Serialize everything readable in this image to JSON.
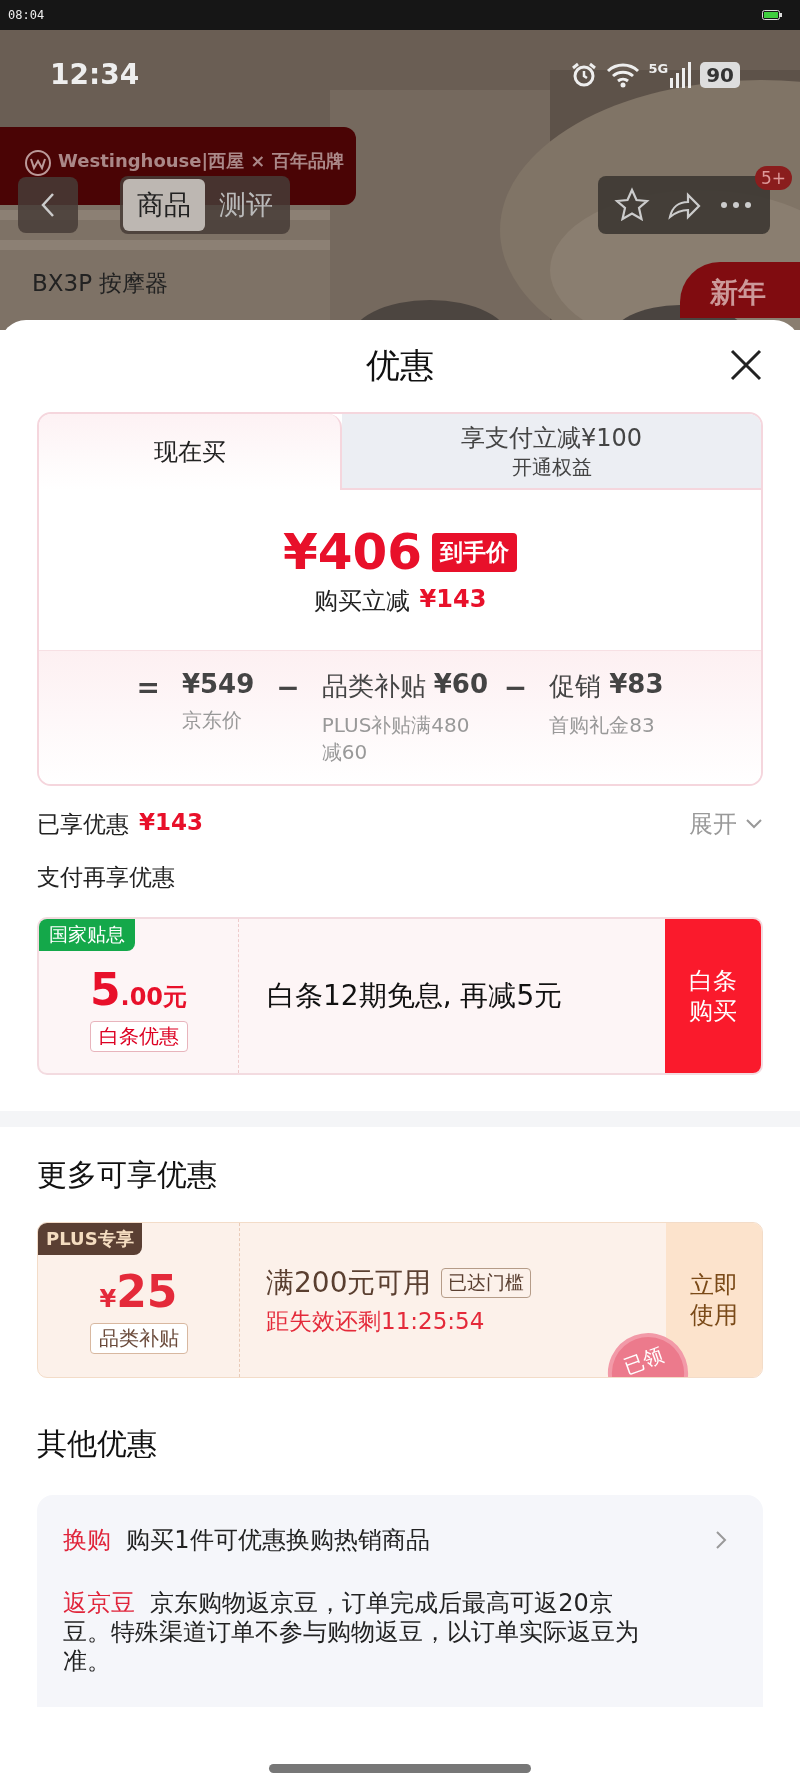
{
  "system_status_bar": {
    "time": "08:04"
  },
  "product_page": {
    "kind": "picture",
    "status_time": "12:34",
    "network": "5G",
    "battery": "90",
    "brand_banner": "Westinghouse|西屋 × 百年品牌",
    "tabs": [
      {
        "label": "商品",
        "selected": true
      },
      {
        "label": "测评",
        "selected": false
      }
    ],
    "message_badge": "5+",
    "subtitle": "BX3P 按摩器",
    "promo_tag": "新年"
  },
  "sheet": {
    "title": "优惠"
  },
  "price_card": {
    "tabs": [
      {
        "label": "现在买",
        "selected": true
      },
      {
        "label": "享支付立减¥100",
        "sublabel": "开通权益",
        "selected": false
      }
    ],
    "price": "¥406",
    "price_tag": "到手价",
    "saving_label": "购买立减",
    "saving": "¥143",
    "breakdown": [
      {
        "op": "=",
        "value": "¥549",
        "note": "京东价"
      },
      {
        "op": "−",
        "name": "品类补贴",
        "value": "¥60",
        "note": "PLUS补贴满480减60"
      },
      {
        "op": "−",
        "name": "促销",
        "value": "¥83",
        "note": "首购礼金83"
      }
    ]
  },
  "enjoyed": {
    "label": "已享优惠",
    "amount": "¥143",
    "toggle": "展开",
    "expanded": false
  },
  "payment_offers": {
    "title": "支付再享优惠",
    "offers": [
      {
        "tag": "国家贴息",
        "amount": "5",
        "decimals": ".00元",
        "type": "白条优惠",
        "description": "白条12期免息, 再减5元",
        "action": "白条购买"
      }
    ]
  },
  "more_offers": {
    "title": "更多可享优惠",
    "coupons": [
      {
        "tag": "PLUS专享",
        "currency": "¥",
        "amount": "25",
        "type": "品类补贴",
        "condition": "满200元可用",
        "status": "已达门槛",
        "countdown": "距失效还剩11:25:54",
        "action": "立即使用",
        "stamp": "已领"
      }
    ]
  },
  "other_offers": {
    "title": "其他优惠",
    "items": [
      {
        "label": "换购",
        "text": "购买1件可优惠换购热销商品",
        "link": true
      },
      {
        "label": "返京豆",
        "text": "京东购物返京豆，订单完成后最高可返20京豆。特殊渠道订单不参与购物返豆，以订单实际返豆为准。",
        "link": false
      }
    ]
  }
}
